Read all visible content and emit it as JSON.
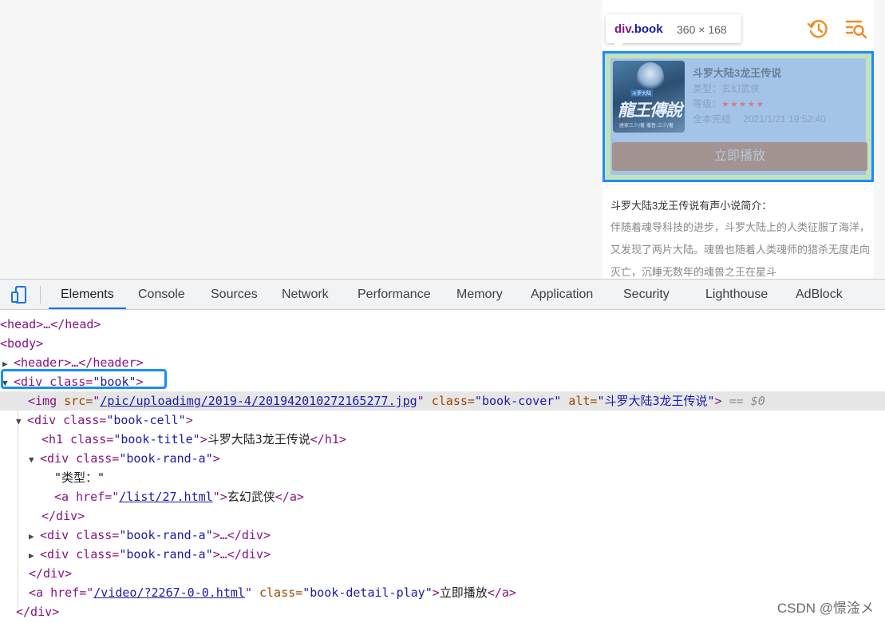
{
  "page": {
    "header_icons": [
      "history-icon",
      "search-list-icon"
    ],
    "book": {
      "title": "斗罗大陆3龙王传说",
      "cover_text": "龍王傳說",
      "cover_top_text": "斗罗大陆",
      "cover_sub_text": "唐家三少/著 播音:三少/著",
      "type_label": "类型：",
      "type_value": "玄幻武侠",
      "level_label": "等级：",
      "level_stars": "★★★★★",
      "status": "全本完结",
      "updated": "2021/1/21 19:52:40",
      "play_label": "立即播放"
    },
    "intro": {
      "title": "斗罗大陆3龙王传说有声小说简介：",
      "text": "伴随着魂导科技的进步，斗罗大陆上的人类征服了海洋，又发现了两片大陆。魂兽也随着人类魂师的猎杀无度走向灭亡，沉睡无数年的魂兽之王在星斗"
    }
  },
  "tooltip": {
    "tag": "div",
    "class": ".book",
    "dimensions": "360 × 168"
  },
  "devtools": {
    "tabs": [
      "Elements",
      "Console",
      "Sources",
      "Network",
      "Performance",
      "Memory",
      "Application",
      "Security",
      "Lighthouse",
      "AdBlock"
    ],
    "active_tab": "Elements",
    "dom": {
      "head": "<head>…</head>",
      "body_open": "<body>",
      "header": "<header>…</header>",
      "book_div": {
        "open": "<div class=",
        "class": "\"book\"",
        "close": ">"
      },
      "img": {
        "tag": "<img",
        "src_attr": " src=",
        "src": "/pic/uploadimg/2019-4/201942010272165277.jpg",
        "class_attr": " class=",
        "class": "\"book-cover\"",
        "alt_attr": " alt=",
        "alt": "\"斗罗大陆3龙王传说\"",
        "close": ">",
        "marker": " == $0"
      },
      "book_cell": {
        "open": "<div class=",
        "class": "\"book-cell\"",
        "close": ">"
      },
      "h1": {
        "open": "<h1 class=",
        "class": "\"book-title\"",
        "mid": ">",
        "text": "斗罗大陆3龙王传说",
        "close": "</h1>"
      },
      "rand_a1": {
        "open": "<div class=",
        "class": "\"book-rand-a\"",
        "close": ">"
      },
      "type_text": "\"类型：\"",
      "a_type": {
        "open": "<a href=",
        "href": "/list/27.html",
        "mid": ">",
        "text": "玄幻武侠",
        "close": "</a>"
      },
      "div_close": "</div>",
      "rand_a2": {
        "open": "<div class=",
        "class": "\"book-rand-a\"",
        "close": ">…</div>"
      },
      "rand_a3": {
        "open": "<div class=",
        "class": "\"book-rand-a\"",
        "close": ">…</div>"
      },
      "cell_close": "</div>",
      "a_play": {
        "open": "<a href=",
        "href": "/video/?2267-0-0.html",
        "class_attr": " class=",
        "class": "\"book-detail-play\"",
        "mid": ">",
        "text": "立即播放",
        "close": "</a>"
      },
      "book_close": "</div>"
    }
  },
  "watermark": "CSDN @憬淦メ",
  "colors": {
    "highlight_border": "#1a8cff",
    "padding_overlay": "#c4e2b9",
    "content_overlay": "#a3c4e8",
    "tag": "#881280",
    "attr_name": "#994500",
    "attr_value": "#1a1aa6"
  }
}
